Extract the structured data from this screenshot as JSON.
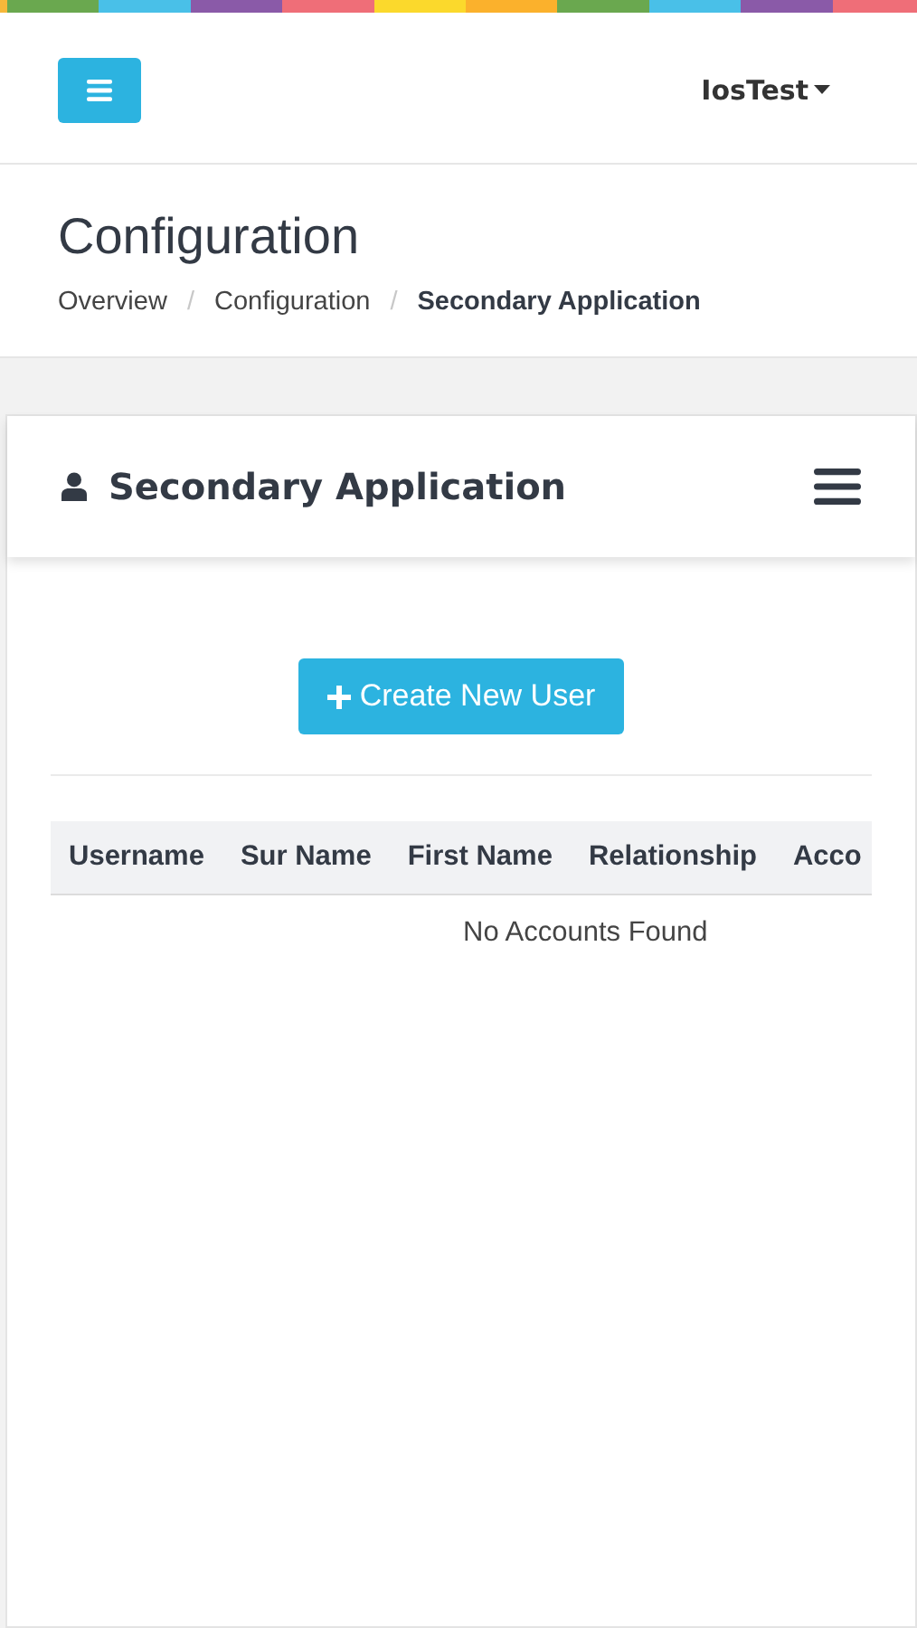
{
  "topbar": {
    "user": "IosTest"
  },
  "page": {
    "title": "Configuration",
    "breadcrumb_separator": "/",
    "breadcrumbs": [
      {
        "label": "Overview",
        "selected": false
      },
      {
        "label": "Configuration",
        "selected": false
      },
      {
        "label": "Secondary Application",
        "selected": true
      }
    ]
  },
  "card": {
    "title": "Secondary Application",
    "create_button": "Create New User",
    "table": {
      "columns": [
        "Username",
        "Sur Name",
        "First Name",
        "Relationship",
        "Acco"
      ],
      "empty_message": "No Accounts Found"
    }
  }
}
